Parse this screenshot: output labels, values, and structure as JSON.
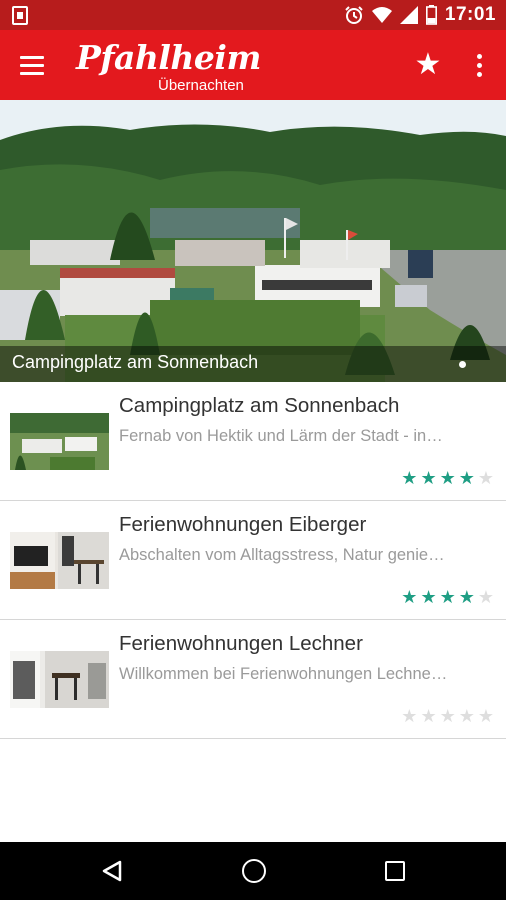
{
  "status_bar": {
    "time": "17:01",
    "icons": [
      "notification-icon",
      "alarm-icon",
      "wifi-icon",
      "signal-icon",
      "battery-icon"
    ]
  },
  "app_bar": {
    "logo_main": "Pfahlheim",
    "logo_sub": "Übernachten",
    "icons": [
      "menu-icon",
      "star-icon",
      "more-vert-icon"
    ]
  },
  "hero": {
    "caption": "Campingplatz am Sonnenbach"
  },
  "items": [
    {
      "title": "Campingplatz am Sonnenbach",
      "description": "Fernab von Hektik und Lärm der Stadt - in…",
      "rating": 4,
      "max_rating": 5
    },
    {
      "title": "Ferienwohnungen Eiberger",
      "description": "Abschalten vom Alltagsstress, Natur genie…",
      "rating": 4,
      "max_rating": 5
    },
    {
      "title": "Ferienwohnungen Lechner",
      "description": "Willkommen bei Ferienwohnungen Lechne…",
      "rating": 0,
      "max_rating": 5
    }
  ],
  "colors": {
    "status_bar": "#b71c1c",
    "app_bar": "#e3191e",
    "star_on": "#1f9e84",
    "star_off": "#dedede"
  },
  "nav_bar": {
    "icons": [
      "back-icon",
      "home-icon",
      "recents-icon"
    ]
  }
}
